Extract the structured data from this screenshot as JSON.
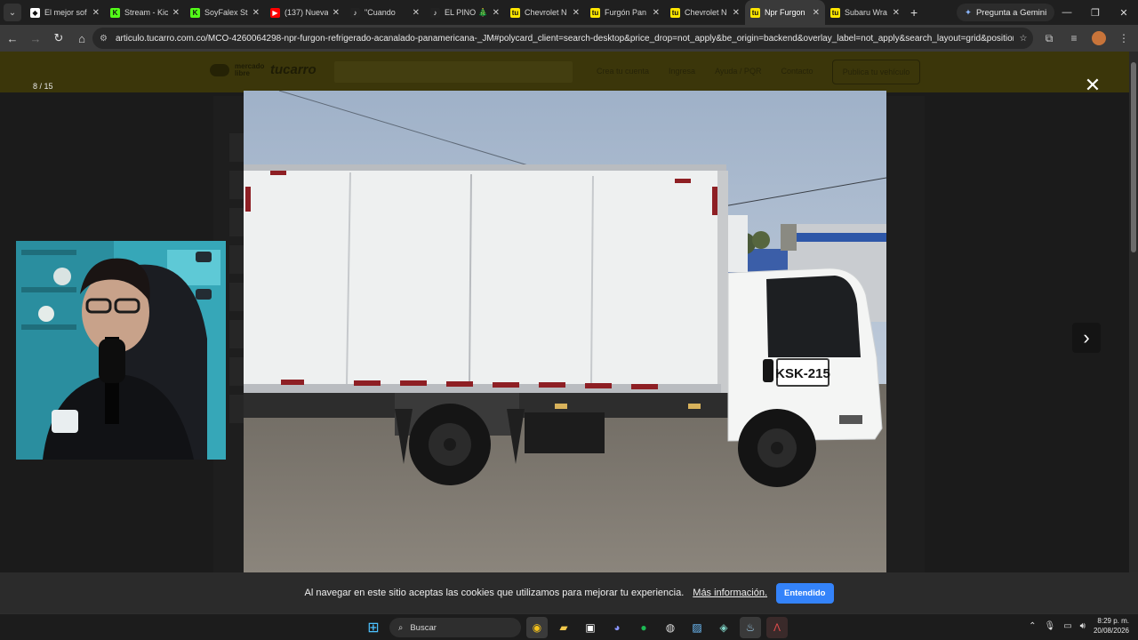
{
  "browser": {
    "tabs": [
      {
        "title": "El mejor sof",
        "favicon_color": "#ffffff",
        "glyph": "◆"
      },
      {
        "title": "Stream - Kic",
        "favicon_color": "#53fc18",
        "glyph": "K"
      },
      {
        "title": "SoyFalex Str",
        "favicon_color": "#53fc18",
        "glyph": "K"
      },
      {
        "title": "(137) Nueva",
        "favicon_color": "#ff0000",
        "glyph": "▶"
      },
      {
        "title": "\"Cuando",
        "favicon_color": "#222222",
        "glyph": "♪"
      },
      {
        "title": "EL PINO 🎄",
        "favicon_color": "#222222",
        "glyph": "♪"
      },
      {
        "title": "Chevrolet N",
        "favicon_color": "#ffe600",
        "glyph": "tu"
      },
      {
        "title": "Furgón Pan",
        "favicon_color": "#ffe600",
        "glyph": "tu"
      },
      {
        "title": "Chevrolet N",
        "favicon_color": "#ffe600",
        "glyph": "tu"
      },
      {
        "title": "Npr Furgon",
        "favicon_color": "#ffe600",
        "glyph": "tu",
        "active": true
      },
      {
        "title": "Subaru Wra",
        "favicon_color": "#ffe600",
        "glyph": "tu"
      }
    ],
    "gemini_label": "Pregunta a Gemini",
    "url": "articulo.tucarro.com.co/MCO-4260064298-npr-furgon-refrigerado-acanalado-panamericana-_JM#polycard_client=search-desktop&price_drop=not_apply&be_origin=backend&overlay_label=not_apply&search_layout=grid&position=15&type..."
  },
  "site": {
    "logo_text": "mercado libre",
    "brand": "tucarro",
    "nav": [
      "Crea tu cuenta",
      "Ingresa",
      "Ayuda / PQR",
      "Contacto"
    ],
    "cta": "Publica tu vehículo"
  },
  "lightbox": {
    "counter": "8 / 15",
    "plate_text": "KSK-215"
  },
  "cookie": {
    "text": "Al navegar en este sitio aceptas las cookies que utilizamos para mejorar tu experiencia.",
    "link": "Más información.",
    "button": "Entendido"
  },
  "taskbar": {
    "search_label": "Buscar",
    "time": "8:29 p. m.",
    "date": "20/08/2026"
  }
}
